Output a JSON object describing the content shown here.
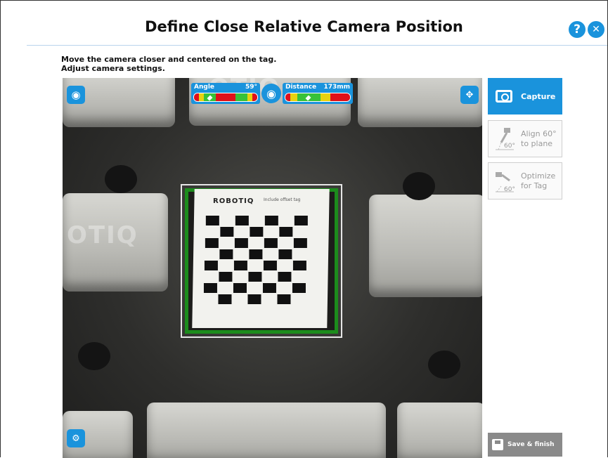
{
  "header": {
    "title": "Define Close Relative Camera Position",
    "help_icon": "help-icon",
    "help_glyph": "?",
    "close_icon": "close-icon",
    "close_glyph": "✕"
  },
  "instructions": {
    "line1": "Move the camera closer and centered on the tag.",
    "line2": "Adjust camera settings."
  },
  "camera_view": {
    "tag_logo_text": "ROBOTIQ",
    "tag_note_text": "Include offset tag",
    "block_emboss_left": "OTIQ",
    "block_emboss_top": "OTIQ",
    "angle_gauge": {
      "label": "Angle",
      "value": "59°",
      "level": 0.26
    },
    "distance_gauge": {
      "label": "Distance",
      "value": "173mm",
      "level": 0.36
    },
    "icons": {
      "eye": "eye-icon",
      "center_eye": "brightness-eye-icon",
      "move": "move-arrows-icon",
      "settings_camera": "camera-settings-icon"
    }
  },
  "right_panel": {
    "capture_label": "Capture",
    "align_label": "Align 60°\nto plane",
    "align_line1": "Align 60°",
    "align_line2": "to plane",
    "optimize_line1": "Optimize",
    "optimize_line2": "for Tag",
    "icon_angle": "60°",
    "save_label": "Save & finish"
  },
  "colors": {
    "accent": "#1a93dc",
    "gauge_red": "#e0101a",
    "gauge_green": "#38c238",
    "gauge_yellow": "#e8d210",
    "tag_border": "#1c8c1c"
  }
}
